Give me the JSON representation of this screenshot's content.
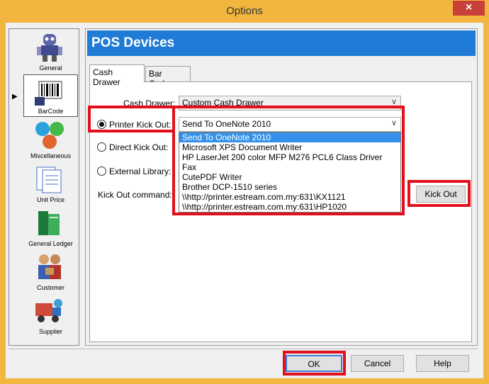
{
  "window": {
    "title": "Options",
    "close_label": "×"
  },
  "sidebar": {
    "items": [
      {
        "label": "General",
        "icon": "robot-icon",
        "selected": false
      },
      {
        "label": "BarCode",
        "icon": "barcode-icon",
        "selected": true
      },
      {
        "label": "Miscellaneous",
        "icon": "globe-icon",
        "selected": false
      },
      {
        "label": "Unit Price",
        "icon": "documents-icon",
        "selected": false
      },
      {
        "label": "General Ledger",
        "icon": "ledger-books-icon",
        "selected": false
      },
      {
        "label": "Customer",
        "icon": "customer-icon",
        "selected": false
      },
      {
        "label": "Supplier",
        "icon": "truck-icon",
        "selected": false
      }
    ],
    "selected_marker": "▶"
  },
  "panel": {
    "title": "POS Devices",
    "tabs": [
      {
        "label": "Cash Drawer",
        "active": true
      },
      {
        "label": "Bar Codes",
        "active": false
      }
    ]
  },
  "cash_drawer": {
    "label": "Cash Drawer:",
    "value": "Custom Cash Drawer",
    "options": {
      "printer_kick_out": {
        "label": "Printer Kick Out:",
        "checked": true
      },
      "direct_kick_out": {
        "label": "Direct Kick Out:",
        "checked": false
      },
      "external_library": {
        "label": "External Library:",
        "checked": false
      }
    },
    "printer_select": {
      "value": "Send To OneNote 2010",
      "options": [
        "Send To OneNote 2010",
        "Microsoft XPS Document Writer",
        "HP LaserJet 200 color MFP M276 PCL6 Class Driver",
        "Fax",
        "CutePDF Writer",
        "Brother DCP-1510 series",
        "\\\\http://printer.estream.com.my:631\\KX1121",
        "\\\\http://printer.estream.com.my:631\\HP1020"
      ]
    },
    "kick_out_command_label": "Kick Out command:",
    "kick_out_button": "Kick Out"
  },
  "footer": {
    "ok": "OK",
    "cancel": "Cancel",
    "help": "Help"
  },
  "colors": {
    "highlight": "#e30f1d",
    "header": "#1f7bd6",
    "selection": "#3391ea",
    "titlebar": "#f2b53e"
  }
}
